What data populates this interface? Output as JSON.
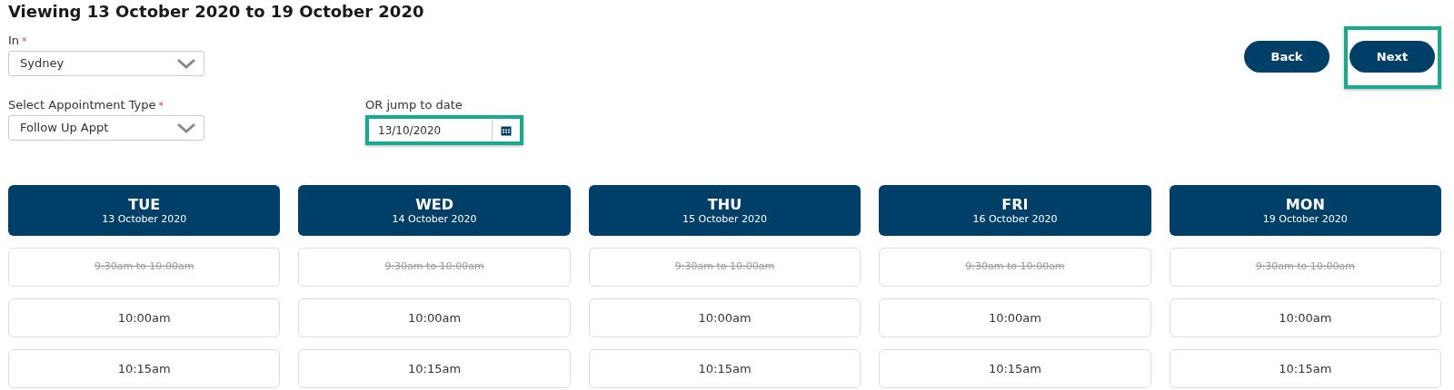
{
  "title": "Viewing 13 October 2020 to 19 October 2020",
  "location": {
    "label": "In",
    "required_mark": "*",
    "value": "Sydney"
  },
  "appointment_type": {
    "label": "Select Appointment Type",
    "required_mark": "*",
    "value": "Follow Up Appt"
  },
  "jump_to_date": {
    "label": "OR jump to date",
    "value": "13/10/2020",
    "highlighted": true
  },
  "buttons": [
    {
      "label": "Back",
      "highlighted": false
    },
    {
      "label": "Next",
      "highlighted": true
    }
  ],
  "days": [
    {
      "day": "TUE",
      "date": "13 October 2020",
      "slots": [
        {
          "label": "9:30am to 10:00am",
          "available": false
        },
        {
          "label": "10:00am",
          "available": true
        },
        {
          "label": "10:15am",
          "available": true
        }
      ]
    },
    {
      "day": "WED",
      "date": "14 October 2020",
      "slots": [
        {
          "label": "9:30am to 10:00am",
          "available": false
        },
        {
          "label": "10:00am",
          "available": true
        },
        {
          "label": "10:15am",
          "available": true
        }
      ]
    },
    {
      "day": "THU",
      "date": "15 October 2020",
      "slots": [
        {
          "label": "9:30am to 10:00am",
          "available": false
        },
        {
          "label": "10:00am",
          "available": true
        },
        {
          "label": "10:15am",
          "available": true
        }
      ]
    },
    {
      "day": "FRI",
      "date": "16 October 2020",
      "slots": [
        {
          "label": "9:30am to 10:00am",
          "available": false
        },
        {
          "label": "10:00am",
          "available": true
        },
        {
          "label": "10:15am",
          "available": true
        }
      ]
    },
    {
      "day": "MON",
      "date": "19 October 2020",
      "slots": [
        {
          "label": "9:30am to 10:00am",
          "available": false
        },
        {
          "label": "10:00am",
          "available": true
        },
        {
          "label": "10:15am",
          "available": true
        }
      ]
    }
  ]
}
